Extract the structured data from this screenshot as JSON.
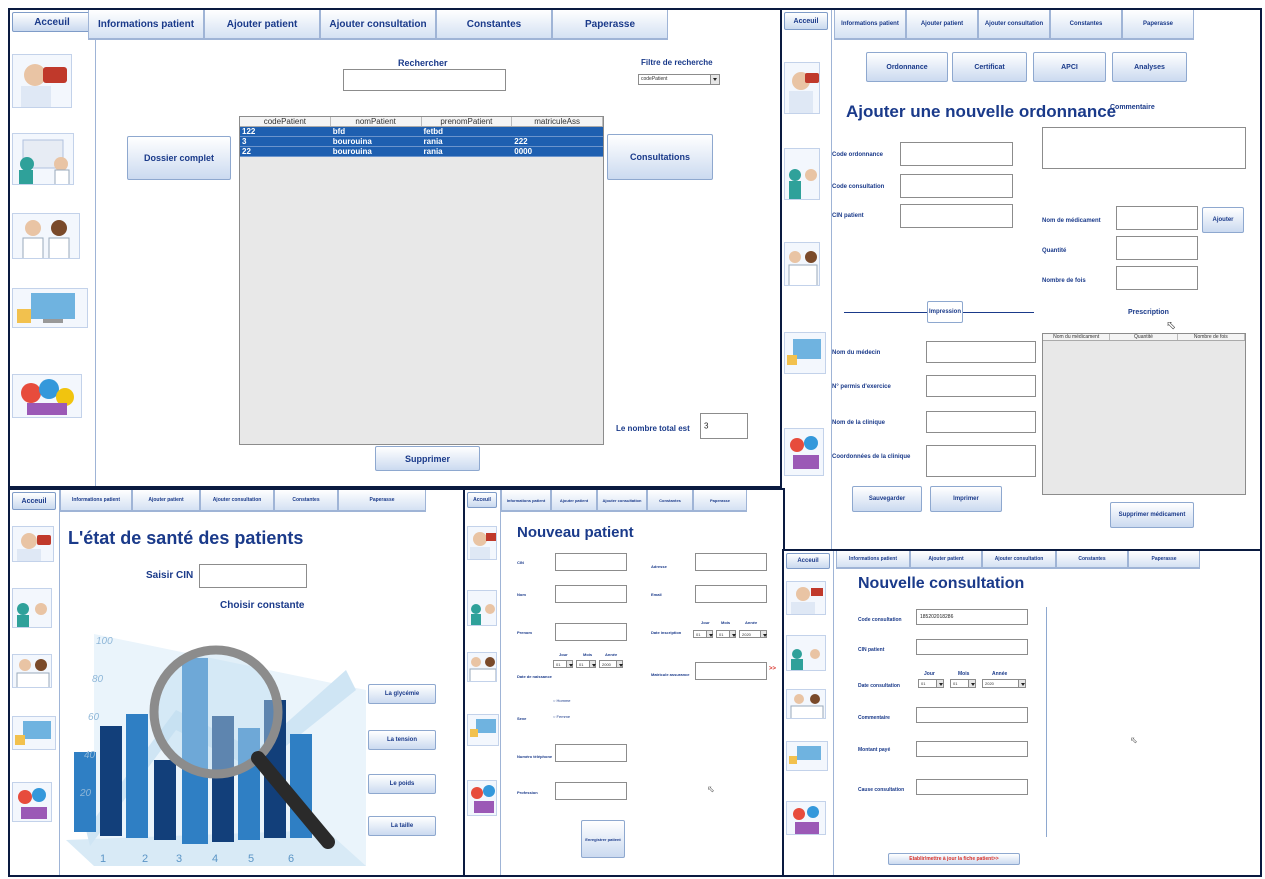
{
  "nav": {
    "acceuil": "Acceuil",
    "tabs": [
      "Informations patient",
      "Ajouter patient",
      "Ajouter consultation",
      "Constantes",
      "Paperasse"
    ]
  },
  "search_panel": {
    "search_label": "Rechercher",
    "filter_label": "Filtre de recherche",
    "filter_value": "codePatient",
    "columns": [
      "codePatient",
      "nomPatient",
      "prenomPatient",
      "matriculeAss"
    ],
    "rows": [
      [
        "122",
        "bfd",
        "fetbd",
        ""
      ],
      [
        "3",
        "bourouina",
        "rania",
        "222"
      ],
      [
        "22",
        "bourouina",
        "rania",
        "0000"
      ]
    ],
    "dossier_button": "Dossier complet",
    "consultations_button": "Consultations",
    "total_label": "Le nombre total est",
    "total_value": "3",
    "delete_button": "Supprimer"
  },
  "ordonnance_panel": {
    "subtabs": [
      "Ordonnance",
      "Certificat",
      "APCI",
      "Analyses"
    ],
    "title": "Ajouter une nouvelle ordonnance",
    "comment_label": "Commentaire",
    "code_ordonnance": "Code ordonnance",
    "code_consultation": "Code consultation",
    "cin_patient": "CIN patient",
    "nom_medicament": "Nom de médicament",
    "ajouter_button": "Ajouter",
    "quantite": "Quantité",
    "nombre_fois": "Nombre de fois",
    "impression": "Impression",
    "prescription": "Prescription",
    "presc_columns": [
      "Nom du médicament",
      "Quantité",
      "Nombre de fois"
    ],
    "nom_medecin": "Nom du médecin",
    "permis": "N° permis d'exercice",
    "clinique": "Nom de la clinique",
    "coord_clinique": "Coordonnées de la clinique",
    "sauvegarder": "Sauvegarder",
    "imprimer": "Imprimer",
    "supprimer_med": "Supprimer médicament"
  },
  "sante_panel": {
    "title": "L'état de santé des patients",
    "cin_label": "Saisir CIN",
    "constante_label": "Choisir constante",
    "buttons": [
      "La glycémie",
      "La tension",
      "Le poids",
      "La taille"
    ],
    "chart_y": [
      "100",
      "80",
      "60",
      "40",
      "20"
    ],
    "chart_x": [
      "1",
      "2",
      "3",
      "4",
      "5",
      "6"
    ]
  },
  "patient_panel": {
    "title": "Nouveau patient",
    "left_fields": [
      "CIN",
      "Nom",
      "Prenom",
      "Date de naissance",
      "Sexe",
      "Numéro téléphone",
      "Profession"
    ],
    "right_fields": [
      "Adresse",
      "Email",
      "Date inscription",
      "Matricule assurance"
    ],
    "date_heads": [
      "Jour",
      "Mois",
      "Année"
    ],
    "birth_values": [
      "01",
      "01",
      "2000"
    ],
    "insc_values": [
      "01",
      "01",
      "2020"
    ],
    "sexe_options": [
      "Homme",
      "Femme"
    ],
    "save_button": "Enregistrer patient",
    "arrow": ">>"
  },
  "consult_panel": {
    "title": "Nouvelle consultation",
    "fields": [
      "Code consultation",
      "CIN patient",
      "Date consultation",
      "Commentaire",
      "Montant payé",
      "Cause consultation"
    ],
    "code_value": "185202018286",
    "date_heads": [
      "Jour",
      "Mois",
      "Année"
    ],
    "date_values": [
      "01",
      "01",
      "2020"
    ],
    "footer": "Etablir/mettre à jour la fiche patient>>"
  }
}
